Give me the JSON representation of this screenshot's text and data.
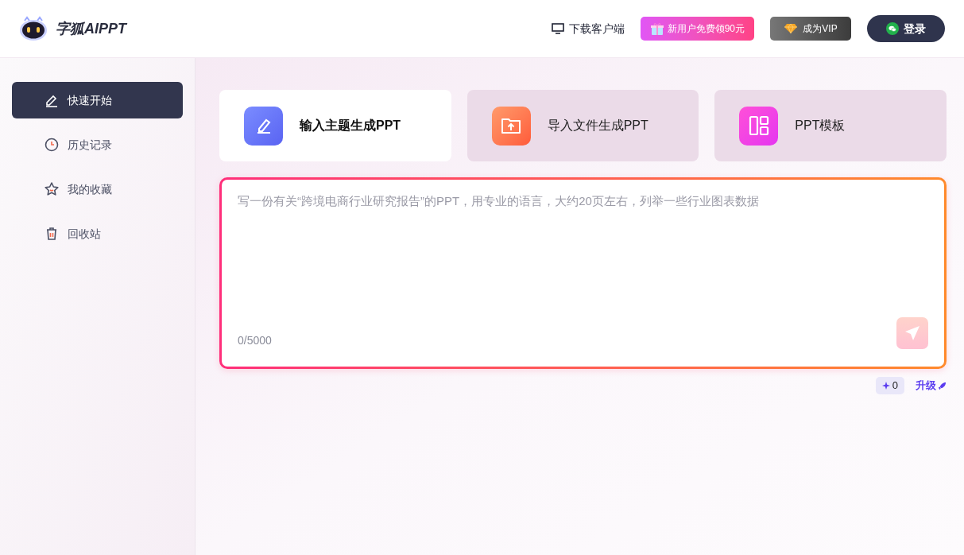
{
  "header": {
    "logo_text": "字狐AIPPT",
    "download": "下载客户端",
    "promo": "新用户免费领90元",
    "vip": "成为VIP",
    "login": "登录"
  },
  "sidebar": {
    "items": [
      {
        "label": "快速开始",
        "selected": true
      },
      {
        "label": "历史记录",
        "selected": false
      },
      {
        "label": "我的收藏",
        "selected": false
      },
      {
        "label": "回收站",
        "selected": false
      }
    ]
  },
  "modes": [
    {
      "label": "输入主题生成PPT",
      "selected": true
    },
    {
      "label": "导入文件生成PPT",
      "selected": false
    },
    {
      "label": "PPT模板",
      "selected": false
    }
  ],
  "prompt": {
    "placeholder": "写一份有关“跨境电商行业研究报告”的PPT，用专业的语言，大约20页左右，列举一些行业图表数据",
    "counter": "0/5000"
  },
  "credits": "0",
  "upgrade": "升级"
}
